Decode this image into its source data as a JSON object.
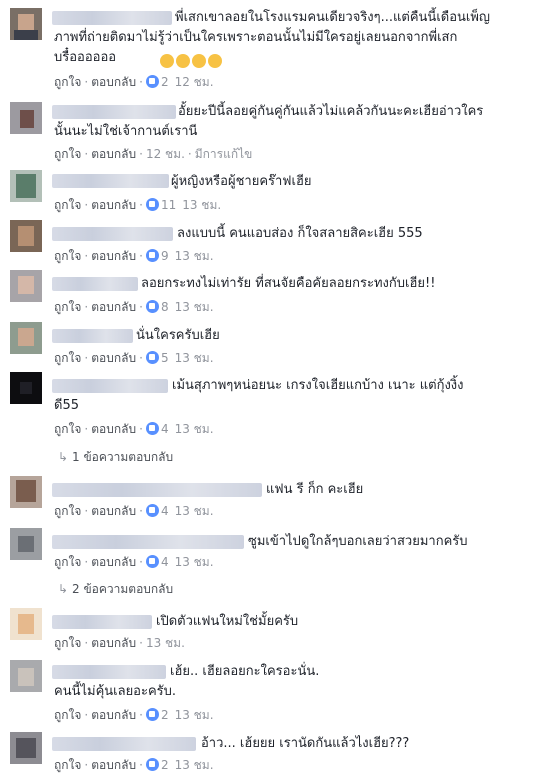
{
  "action_labels": {
    "like": "ถูกใจ",
    "reply": "ตอบกลับ"
  },
  "comments": [
    {
      "text": "พี่เสกเขาลอยในโรงแรมคนเดียวจริงๆ...แต่คืนนี้เดือนเพ็ญ\nภาพที่ถ่ายติดมาไม่รู้ว่าเป็นใครเพราะตอนนั้นไม่มีใครอยู่เลยนอกจากพี่เสก\nบรื๋ออออออ",
      "emoji": 4,
      "likes": "2",
      "time": "12 ชม.",
      "edited": ""
    },
    {
      "text": "อั้ยยะปีนี้ลอยคู่กันคู่กันแล้วไม่แคล้วกันนะคะเฮียอ่าวใคร\nนั้นนะไม่ใช่เจ้ากานต์เรานี",
      "likes": "",
      "time": "12 ชม.",
      "edited": "มีการแก้ไข"
    },
    {
      "text": "ผู้หญิงหรือผู้ชายคร๊าฟเฮีย",
      "likes": "11",
      "time": "13 ชม.",
      "edited": ""
    },
    {
      "text": "ลงแบบนี้ คนแอบส่อง ก็ใจสลายสิคะเฮีย 555",
      "likes": "9",
      "time": "13 ชม.",
      "edited": ""
    },
    {
      "text": "ลอยกระทงไม่เท่ารัย ที่สนจัยคือคัยลอยกระทงกับเฮีย!!",
      "likes": "8",
      "time": "13 ชม.",
      "edited": ""
    },
    {
      "text": "นั่นใครครับเฮีย",
      "likes": "5",
      "time": "13 ชม.",
      "edited": ""
    },
    {
      "text": "เม้นสุภาพๆหน่อยนะ เกรงใจเฮียแกบ้าง เนาะ แต่กุ้งงิ้ง\nดี55",
      "likes": "4",
      "time": "13 ชม.",
      "edited": "",
      "replies": "1 ข้อความตอบกลับ"
    },
    {
      "text": "แฟน รี ก็ก คะเฮีย",
      "likes": "4",
      "time": "13 ชม.",
      "edited": ""
    },
    {
      "text": "ซูมเข้าไปดูใกล้ๆบอกเลยว่าสวยมากครับ",
      "likes": "4",
      "time": "13 ชม.",
      "edited": "",
      "replies": "2 ข้อความตอบกลับ"
    },
    {
      "text": "เปิดตัวแฟนใหม่ใช่มั้ยครับ",
      "likes": "",
      "time": "13 ชม.",
      "edited": ""
    },
    {
      "text": "เฮ้ย.. เฮียลอยกะใครอะนั่น.\nคนนี้ไม่คุ้นเลยอะครับ.",
      "likes": "2",
      "time": "13 ชม.",
      "edited": ""
    },
    {
      "text": "อ้าว... เฮ้ยยย เรานัดกันแล้วไงเฮีย???",
      "likes": "2",
      "time": "13 ชม.",
      "edited": ""
    }
  ]
}
